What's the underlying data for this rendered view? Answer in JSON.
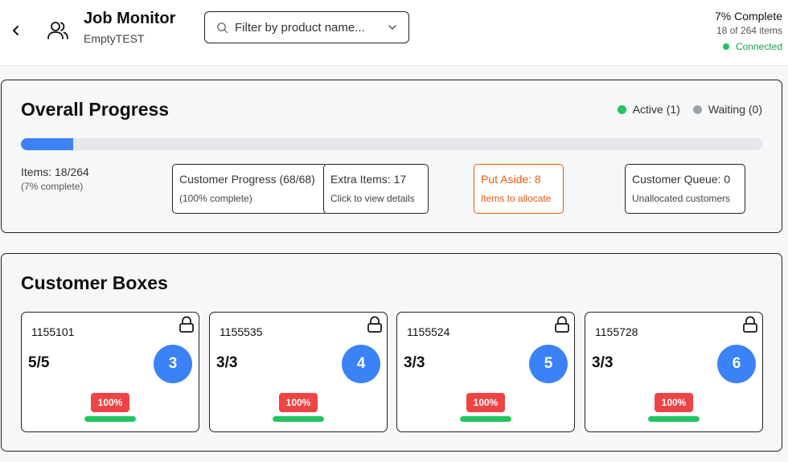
{
  "header": {
    "title": "Job Monitor",
    "subtitle": "EmptyTEST",
    "filter_placeholder": "Filter by product name...",
    "completion": "7% Complete",
    "items_summary": "18 of 264 items",
    "connection_status": "Connected",
    "connection_color": "#22c55e"
  },
  "overall": {
    "title": "Overall Progress",
    "legend": [
      {
        "label": "Active (1)",
        "color": "#22c55e"
      },
      {
        "label": "Waiting (0)",
        "color": "#9ca3af"
      }
    ],
    "progress_fraction": 0.07,
    "progress_color": "#3b82f6",
    "items_label": "Items: 18/264",
    "items_sub": "(7% complete)",
    "stats": [
      {
        "main": "Customer Progress (68/68)",
        "sub": "(100% complete)"
      },
      {
        "main": "Extra Items: 17",
        "sub": "Click to view details"
      },
      {
        "main": "Put Aside: 8",
        "sub": "Items to allocate"
      },
      {
        "main": "Customer Queue: 0",
        "sub": "Unallocated customers"
      }
    ]
  },
  "boxes": {
    "title": "Customer Boxes",
    "items": [
      {
        "id": "1155101",
        "count": "5/5",
        "number": "3",
        "percent": "100%",
        "fill": 1.0
      },
      {
        "id": "1155535",
        "count": "3/3",
        "number": "4",
        "percent": "100%",
        "fill": 1.0
      },
      {
        "id": "1155524",
        "count": "3/3",
        "number": "5",
        "percent": "100%",
        "fill": 1.0
      },
      {
        "id": "1155728",
        "count": "3/3",
        "number": "6",
        "percent": "100%",
        "fill": 1.0
      }
    ]
  }
}
